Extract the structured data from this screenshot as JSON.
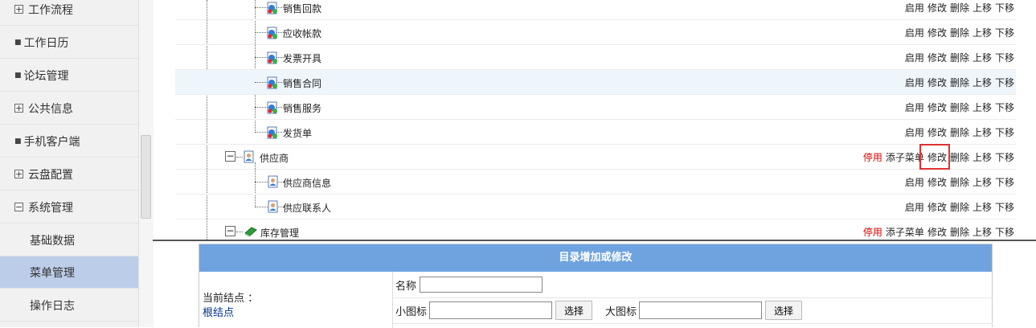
{
  "sidebar": {
    "items": [
      {
        "label": "工作流程",
        "marker": "+"
      },
      {
        "label": "工作日历",
        "marker": "■"
      },
      {
        "label": "论坛管理",
        "marker": "■"
      },
      {
        "label": "公共信息",
        "marker": "+"
      },
      {
        "label": "手机客户端",
        "marker": "■"
      },
      {
        "label": "云盘配置",
        "marker": "+"
      },
      {
        "label": "系统管理",
        "marker": "−"
      },
      {
        "label": "基础数据",
        "marker": ""
      },
      {
        "label": "菜单管理",
        "marker": ""
      },
      {
        "label": "操作日志",
        "marker": ""
      }
    ]
  },
  "tree": {
    "rows": [
      {
        "label": "销售回款",
        "a": [
          "启用",
          "修改",
          "删除",
          "上移",
          "下移"
        ]
      },
      {
        "label": "应收帐款",
        "a": [
          "启用",
          "修改",
          "删除",
          "上移",
          "下移"
        ]
      },
      {
        "label": "发票开具",
        "a": [
          "启用",
          "修改",
          "删除",
          "上移",
          "下移"
        ]
      },
      {
        "label": "销售合同",
        "a": [
          "启用",
          "修改",
          "删除",
          "上移",
          "下移"
        ]
      },
      {
        "label": "销售服务",
        "a": [
          "启用",
          "修改",
          "删除",
          "上移",
          "下移"
        ]
      },
      {
        "label": "发货单",
        "a": [
          "启用",
          "修改",
          "删除",
          "上移",
          "下移"
        ]
      },
      {
        "label": "供应商",
        "a": [
          "停用",
          "添子菜单",
          "修改",
          "删除",
          "上移",
          "下移"
        ]
      },
      {
        "label": "供应商信息",
        "a": [
          "启用",
          "修改",
          "删除",
          "上移",
          "下移"
        ]
      },
      {
        "label": "供应联系人",
        "a": [
          "启用",
          "修改",
          "删除",
          "上移",
          "下移"
        ]
      },
      {
        "label": "库存管理",
        "a": [
          "停用",
          "添子菜单",
          "修改",
          "删除",
          "上移",
          "下移"
        ]
      }
    ]
  },
  "form": {
    "title": "目录增加或修改",
    "current_node_label": "当前结点 ：",
    "current_node_value": "根结点",
    "name_label": "名称",
    "name_value": "",
    "small_icon_label": "小图标",
    "small_icon_value": "",
    "choose_label": "选择",
    "large_icon_label": "大图标",
    "large_icon_value": ""
  }
}
